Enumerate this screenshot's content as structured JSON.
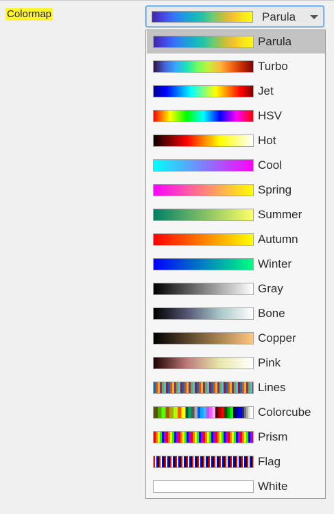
{
  "label": {
    "text": "Colormap"
  },
  "dropdown": {
    "selected_label": "Parula",
    "selected_swatch": "parula"
  },
  "list": {
    "items": [
      {
        "label": "Parula",
        "swatch": "parula",
        "selected": true
      },
      {
        "label": "Turbo",
        "swatch": "turbo"
      },
      {
        "label": "Jet",
        "swatch": "jet"
      },
      {
        "label": "HSV",
        "swatch": "hsv"
      },
      {
        "label": "Hot",
        "swatch": "hot"
      },
      {
        "label": "Cool",
        "swatch": "cool"
      },
      {
        "label": "Spring",
        "swatch": "spring"
      },
      {
        "label": "Summer",
        "swatch": "summer"
      },
      {
        "label": "Autumn",
        "swatch": "autumn"
      },
      {
        "label": "Winter",
        "swatch": "winter"
      },
      {
        "label": "Gray",
        "swatch": "gray"
      },
      {
        "label": "Bone",
        "swatch": "bone"
      },
      {
        "label": "Copper",
        "swatch": "copper"
      },
      {
        "label": "Pink",
        "swatch": "pink"
      },
      {
        "label": "Lines",
        "swatch": "lines"
      },
      {
        "label": "Colorcube",
        "swatch": "colorcube"
      },
      {
        "label": "Prism",
        "swatch": "prism"
      },
      {
        "label": "Flag",
        "swatch": "flag"
      },
      {
        "label": "White",
        "swatch": "white"
      }
    ]
  }
}
